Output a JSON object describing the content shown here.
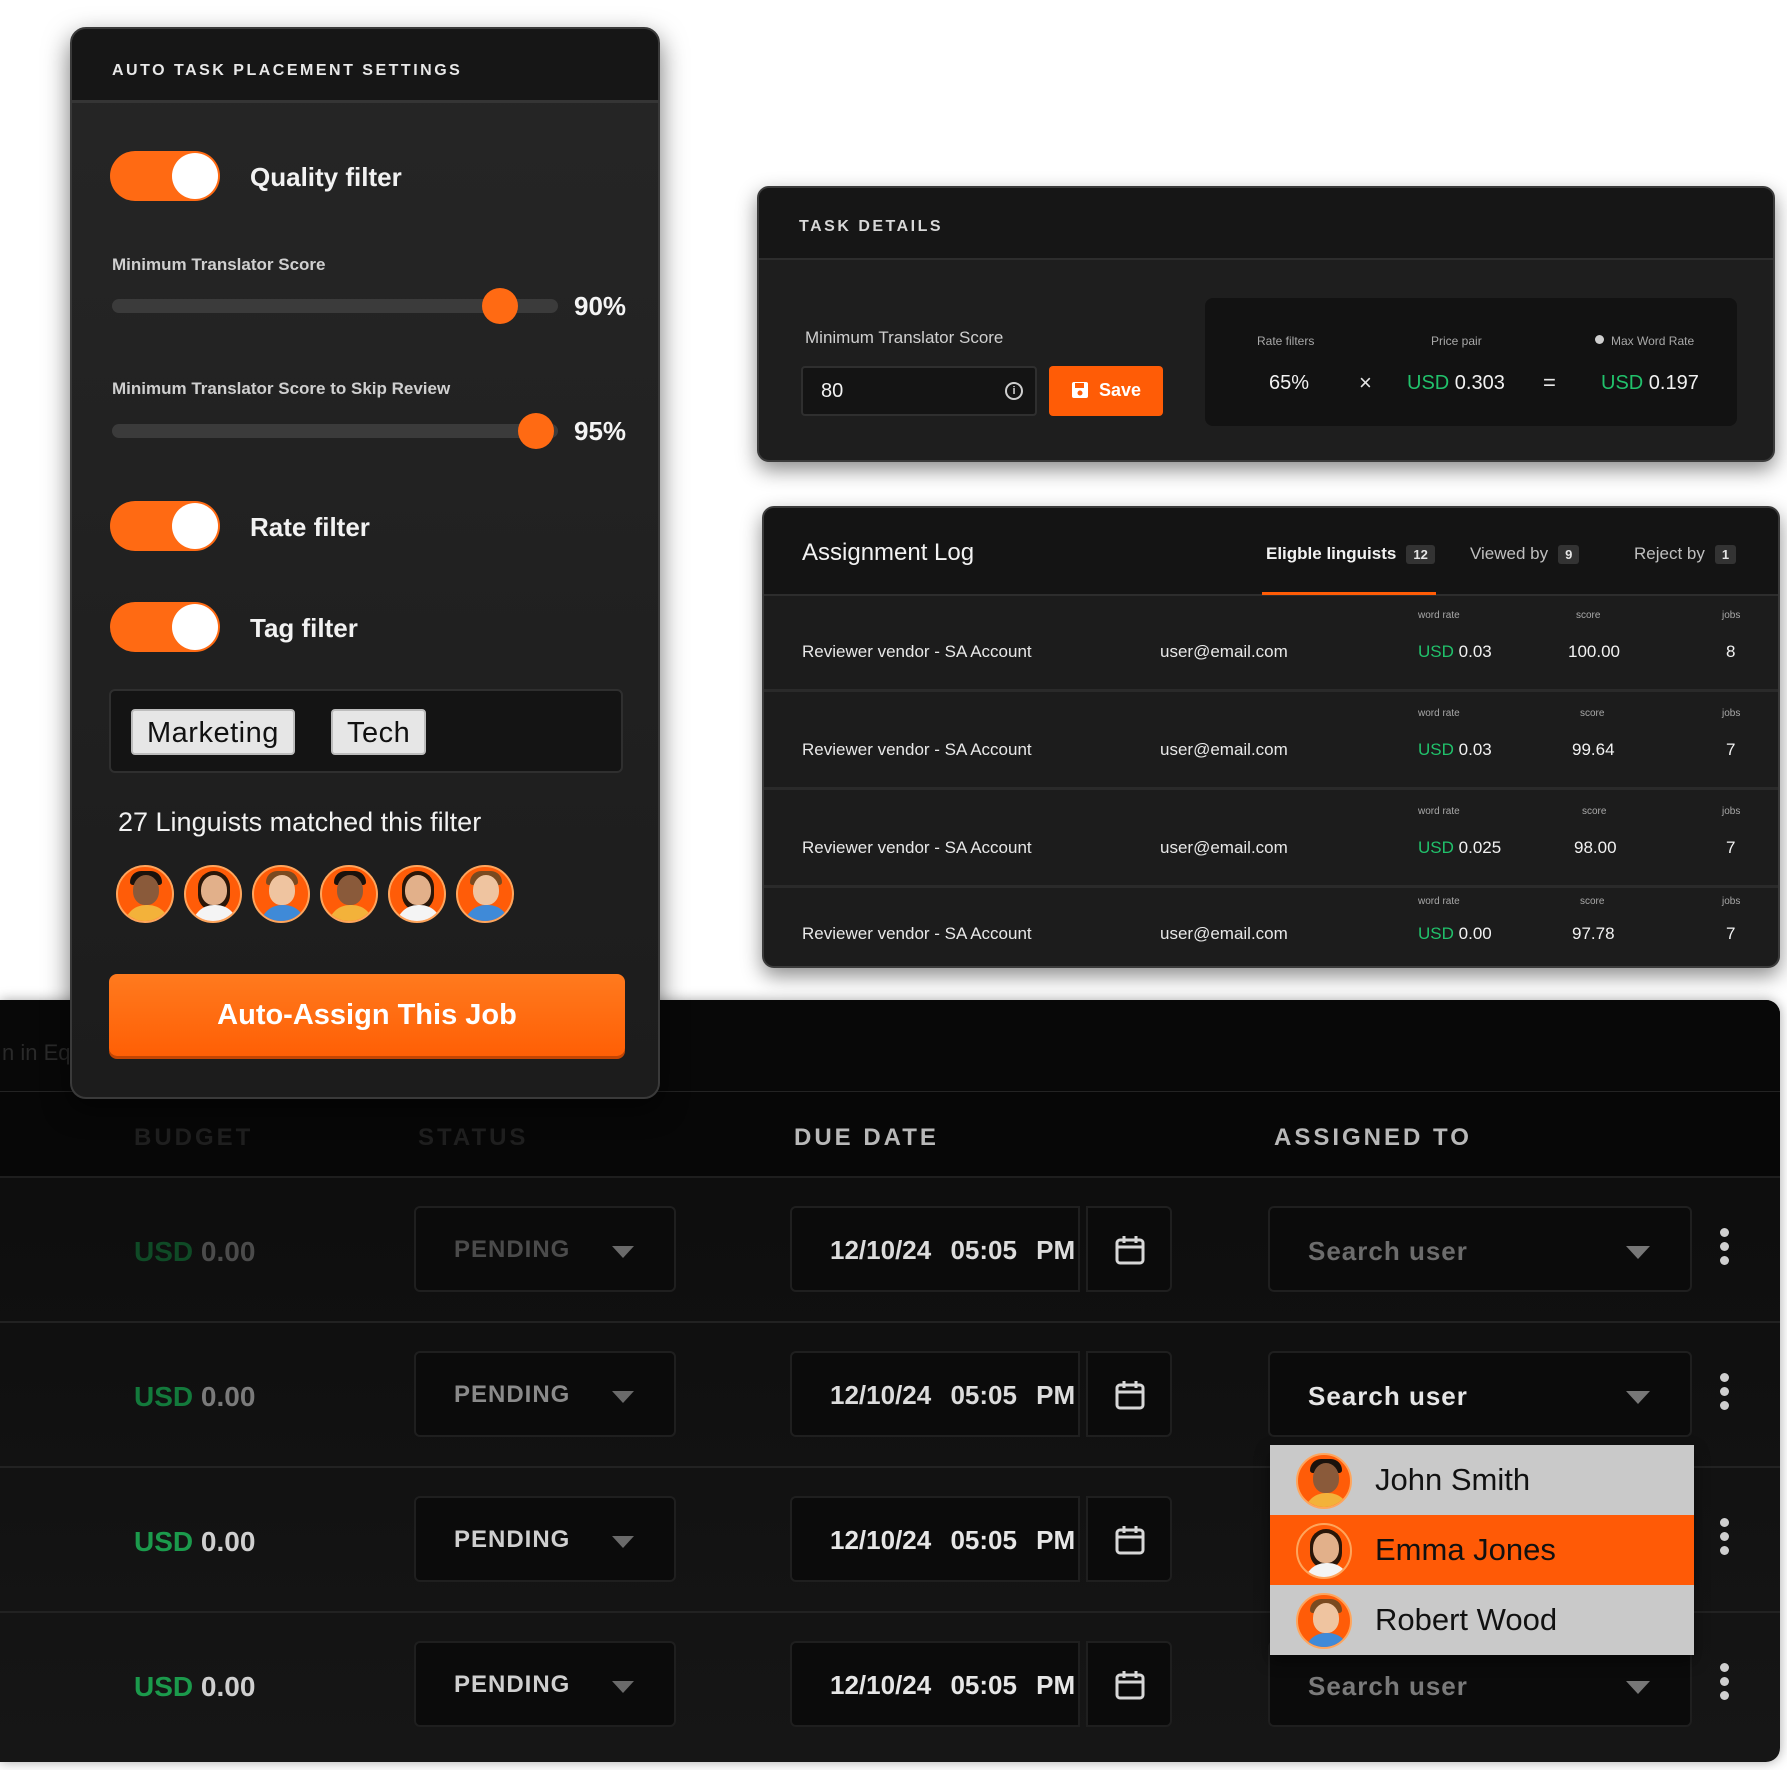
{
  "colors": {
    "accent": "#ff6a13",
    "currency_green": "#21c16b",
    "panel_bg": "#1e1e1e"
  },
  "settings": {
    "title": "AUTO TASK PLACEMENT SETTINGS",
    "quality_filter": {
      "label": "Quality filter",
      "on": true
    },
    "min_score": {
      "label": "Minimum Translator Score",
      "value_text": "90%",
      "value": 0.9
    },
    "skip_review": {
      "label": "Minimum Translator Score to Skip Review",
      "value_text": "95%",
      "value": 0.95
    },
    "rate_filter": {
      "label": "Rate filter",
      "on": true
    },
    "tag_filter": {
      "label": "Tag filter",
      "on": true
    },
    "tags": [
      "Marketing",
      "Tech"
    ],
    "matched_text": "27 Linguists matched this filter",
    "assign_button": "Auto-Assign This Job"
  },
  "task_details": {
    "title": "TASK DETAILS",
    "score_label": "Minimum Translator Score",
    "score_value": "80",
    "save_label": "Save",
    "rate_filters_label": "Rate filters",
    "price_pair_label": "Price pair",
    "max_word_rate_label": "Max Word Rate",
    "rate_filters_value": "65%",
    "multiply": "×",
    "equals": "=",
    "price_pair_currency": "USD",
    "price_pair_value": "0.303",
    "max_rate_currency": "USD",
    "max_rate_value": "0.197"
  },
  "assignment_log": {
    "title": "Assignment Log",
    "tabs": [
      {
        "label": "Eligble linguists",
        "count": "12"
      },
      {
        "label": "Viewed by",
        "count": "9"
      },
      {
        "label": "Reject by",
        "count": "1"
      }
    ],
    "mini_labels": {
      "word_rate": "word rate",
      "score": "score",
      "jobs": "jobs"
    },
    "rows": [
      {
        "vendor": "Reviewer vendor - SA Account",
        "email": "user@email.com",
        "currency": "USD",
        "rate": "0.03",
        "score": "100.00",
        "jobs": "8"
      },
      {
        "vendor": "Reviewer vendor - SA Account",
        "email": "user@email.com",
        "currency": "USD",
        "rate": "0.03",
        "score": "99.64",
        "jobs": "7"
      },
      {
        "vendor": "Reviewer vendor - SA Account",
        "email": "user@email.com",
        "currency": "USD",
        "rate": "0.025",
        "score": "98.00",
        "jobs": "7"
      },
      {
        "vendor": "Reviewer vendor - SA Account",
        "email": "user@email.com",
        "currency": "USD",
        "rate": "0.00",
        "score": "97.78",
        "jobs": "7"
      }
    ]
  },
  "jobs_table": {
    "ghost_text": "n in Eq",
    "columns": {
      "budget": "BUDGET",
      "status": "STATUS",
      "due_date": "DUE DATE",
      "assigned_to": "ASSIGNED TO"
    },
    "rows": [
      {
        "currency": "USD",
        "amount": "0.00",
        "status": "PENDING",
        "date": "12/10/24",
        "time": "05:05 PM",
        "assignee": "Search user"
      },
      {
        "currency": "USD",
        "amount": "0.00",
        "status": "PENDING",
        "date": "12/10/24",
        "time": "05:05 PM",
        "assignee": "Search user"
      },
      {
        "currency": "USD",
        "amount": "0.00",
        "status": "PENDING",
        "date": "12/10/24",
        "time": "05:05 PM",
        "assignee": ""
      },
      {
        "currency": "USD",
        "amount": "0.00",
        "status": "PENDING",
        "date": "12/10/24",
        "time": "05:05 PM",
        "assignee": "Search user"
      }
    ],
    "user_dropdown": {
      "options": [
        "John Smith",
        "Emma Jones",
        "Robert Wood"
      ],
      "selected": "Emma Jones"
    }
  }
}
